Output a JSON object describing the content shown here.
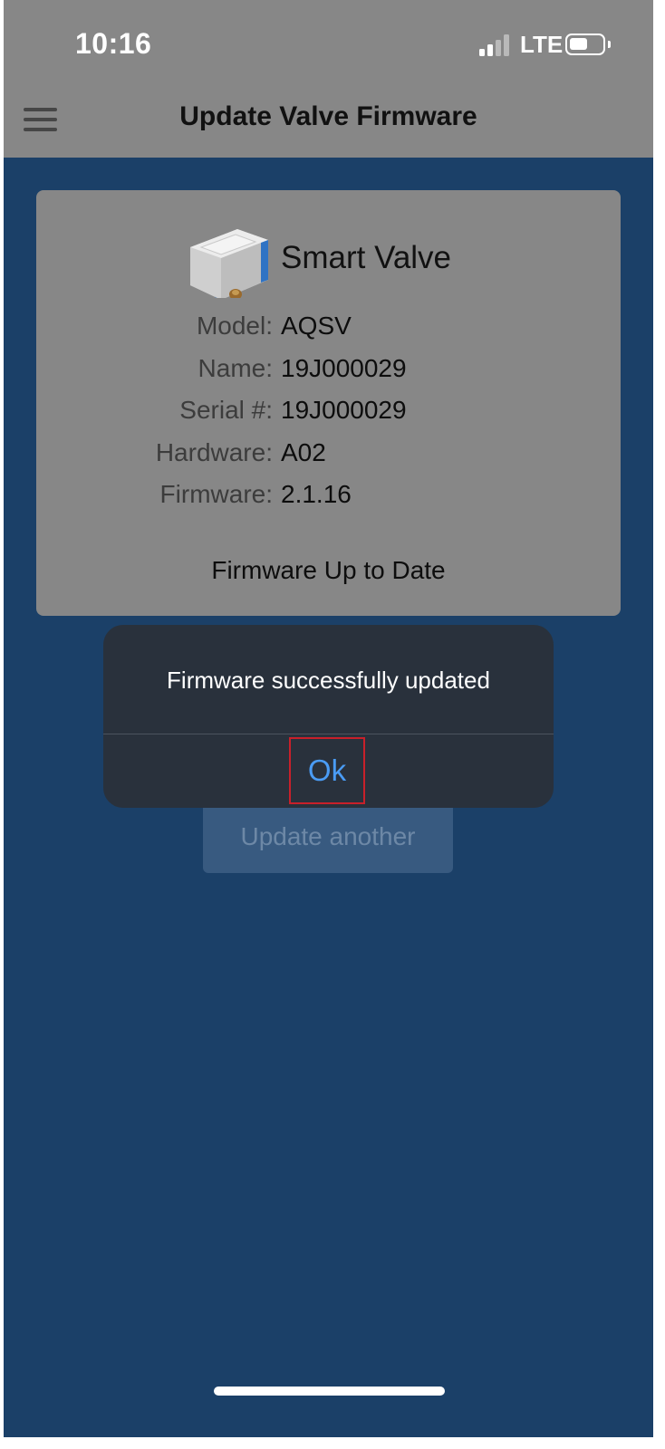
{
  "status_bar": {
    "time": "10:16",
    "carrier": "LTE",
    "signal_bars_active": 2,
    "signal_bars_total": 4,
    "battery_level": 0.55
  },
  "nav": {
    "title": "Update Valve Firmware",
    "menu_icon": "hamburger-menu-icon"
  },
  "device": {
    "name": "Smart Valve",
    "image": "smart-valve-device-image",
    "fields": [
      {
        "label": "Model:",
        "value": "AQSV"
      },
      {
        "label": "Name:",
        "value": "19J000029"
      },
      {
        "label": "Serial #:",
        "value": "19J000029"
      },
      {
        "label": "Hardware:",
        "value": "A02"
      },
      {
        "label": "Firmware:",
        "value": "2.1.16"
      }
    ],
    "firmware_status": "Firmware Up to Date"
  },
  "actions": {
    "update_another_label": "Update another"
  },
  "alert": {
    "message": "Firmware successfully updated",
    "ok_label": "Ok"
  },
  "colors": {
    "background": "#1b4068",
    "header_dimmed": "#878787",
    "alert_bg": "#29313c",
    "ok_blue": "#4a9cf5",
    "highlight_red": "#c8202a"
  }
}
